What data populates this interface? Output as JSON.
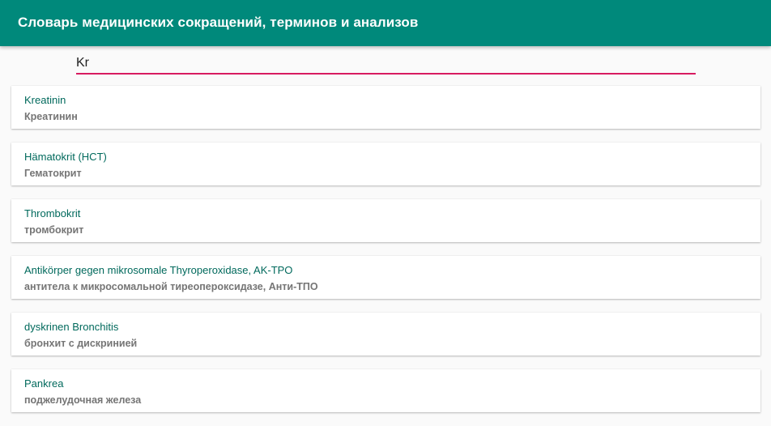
{
  "app_bar": {
    "title": "Словарь медицинских сокращений, терминов и анализов",
    "color": "#00897b"
  },
  "search": {
    "value": "Kr",
    "underline_color": "#d81b60"
  },
  "results": [
    {
      "term": "Kreatinin",
      "translation": "Креатинин"
    },
    {
      "term": "Hämatokrit (HCT)",
      "translation": "Гематокрит"
    },
    {
      "term": "Thrombokrit",
      "translation": "тромбокрит"
    },
    {
      "term": "Antikörper gegen mikrosomale Thyroperoxidase, AK-TPO",
      "translation": "антитела к микросомальной тиреопероксидазе, Анти-ТПО"
    },
    {
      "term": "dyskrinen Bronchitis",
      "translation": "бронхит с дискринией"
    },
    {
      "term": "Pankrea",
      "translation": "поджелудочная железа"
    }
  ]
}
